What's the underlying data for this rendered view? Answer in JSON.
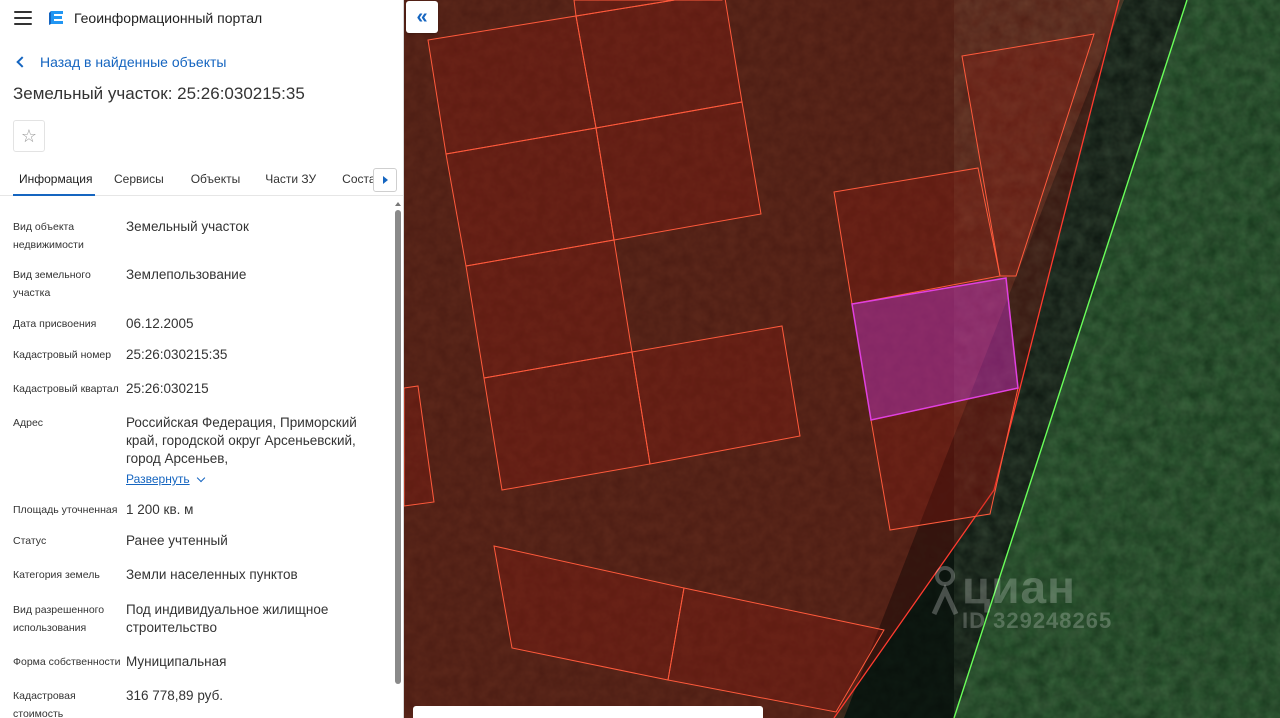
{
  "header": {
    "portal_title": "Геоинформационный портал"
  },
  "nav": {
    "back_label": "Назад в найденные объекты"
  },
  "page": {
    "title": "Земельный участок: 25:26:030215:35",
    "favorite_icon": "☆"
  },
  "tabs": [
    {
      "label": "Информация",
      "active": true
    },
    {
      "label": "Сервисы",
      "active": false
    },
    {
      "label": "Объекты",
      "active": false
    },
    {
      "label": "Части ЗУ",
      "active": false
    },
    {
      "label": "Состав",
      "active": false
    }
  ],
  "properties": [
    {
      "label": "Вид объекта недвижимости",
      "value": "Земельный участок"
    },
    {
      "label": "Вид земельного участка",
      "value": "Землепользование"
    },
    {
      "label": "Дата присвоения",
      "value": "06.12.2005"
    },
    {
      "label": "Кадастровый номер",
      "value": "25:26:030215:35"
    },
    {
      "label": "Кадастровый квартал",
      "value": "25:26:030215"
    },
    {
      "label": "Адрес",
      "value": "Российская Федерация, Приморский край, городской округ Арсеньевский, город Арсеньев,",
      "action": "Развернуть"
    },
    {
      "label": "Площадь уточненная",
      "value": "1 200 кв. м"
    },
    {
      "label": "Статус",
      "value": "Ранее учтенный"
    },
    {
      "label": "Категория земель",
      "value": "Земли населенных пунктов"
    },
    {
      "label": "Вид разрешенного использования",
      "value": "Под индивидуальное жилищное строительство"
    },
    {
      "label": "Форма собственности",
      "value": "Муниципальная"
    },
    {
      "label": "Кадастровая стоимость",
      "value": "316 778,89 руб."
    }
  ],
  "map": {
    "collapse_icon": "«",
    "watermark_brand": "циан",
    "watermark_id": "ID 329248265",
    "colors": {
      "parcel_stroke": "#ff5a3c",
      "selected_stroke": "#d63cd6",
      "boundary_line": "#6aff5a",
      "forest": "#1f4a26",
      "terrain": "#4a2f22"
    }
  }
}
